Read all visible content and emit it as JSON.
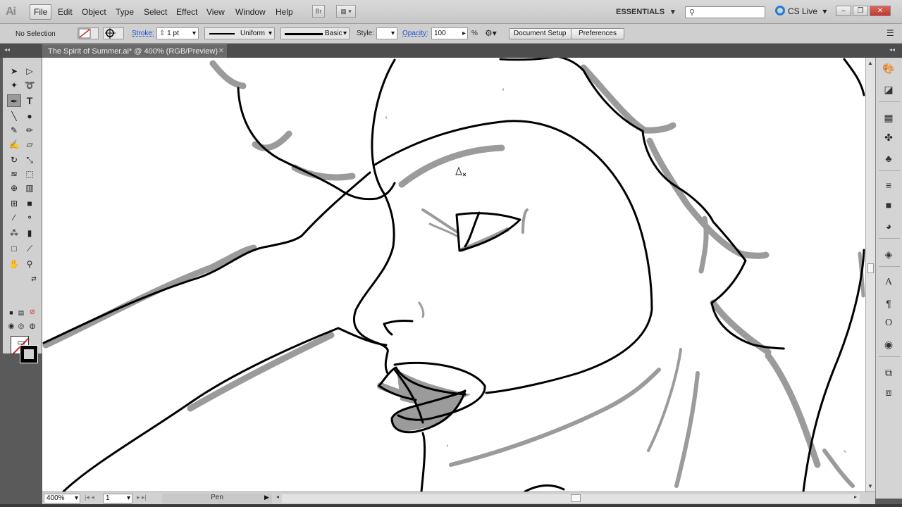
{
  "app": {
    "logo": "Ai"
  },
  "menu": {
    "items": [
      "File",
      "Edit",
      "Object",
      "Type",
      "Select",
      "Effect",
      "View",
      "Window",
      "Help"
    ],
    "bridge_label": "Br",
    "workspace": "ESSENTIALS",
    "search_placeholder": "",
    "cslive": "CS Live"
  },
  "control": {
    "selection": "No Selection",
    "stroke_label": "Stroke:",
    "stroke_weight": "1 pt",
    "profile": "Uniform",
    "brush": "Basic",
    "style_label": "Style:",
    "opacity_label": "Opacity:",
    "opacity_value": "100",
    "opacity_unit": "%",
    "document_setup": "Document Setup",
    "preferences": "Preferences"
  },
  "document": {
    "tab_title": "The Spirit of Summer.ai* @ 400% (RGB/Preview)",
    "close": "✕"
  },
  "status": {
    "zoom": "400%",
    "page": "1",
    "tool": "Pen"
  },
  "colors": {
    "fill": "none",
    "stroke": "#000000",
    "shade": "#9b9b9b",
    "accent": "#1a4fd0"
  }
}
